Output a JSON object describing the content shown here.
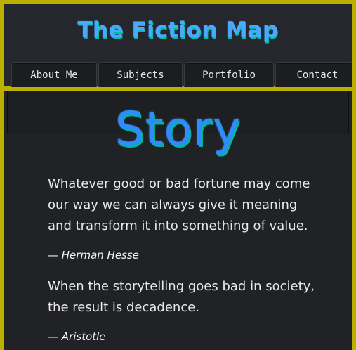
{
  "header": {
    "title": "The Fiction Map"
  },
  "nav": {
    "items": [
      {
        "label": "About Me"
      },
      {
        "label": "Subjects"
      },
      {
        "label": "Portfolio"
      },
      {
        "label": "Contact"
      }
    ]
  },
  "main": {
    "heading": "Story",
    "quotes": [
      {
        "text": "Whatever good or bad fortune may come our way we can always give it meaning and transform it into something of value.",
        "dash": "—",
        "author": "Herman Hesse"
      },
      {
        "text": "When the storytelling goes bad in society, the result is decadence.",
        "dash": "—",
        "author": "Aristotle"
      }
    ]
  },
  "colors": {
    "frame_border": "#b9b000",
    "title_blue": "#2f8cff",
    "title_shadow": "#00b896",
    "background": "#202226"
  }
}
